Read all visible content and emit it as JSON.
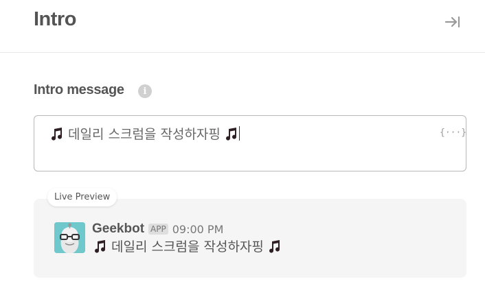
{
  "header": {
    "title": "Intro",
    "collapse_icon": "collapse-right-icon"
  },
  "intro_message": {
    "label": "Intro message",
    "info_icon": "info-icon",
    "info_glyph": "i",
    "prefix_icon": "music-note-icon",
    "text": "데일리 스크럼을 작성하자핑",
    "suffix_icon": "music-note-icon",
    "variables_icon": "variables-icon",
    "variables_glyph": "{···}"
  },
  "live_preview": {
    "label": "Live Preview",
    "bot_name": "Geekbot",
    "badge": "APP",
    "time": "09:00 PM",
    "message": "데일리 스크럼을 작성하자핑",
    "avatar_icon": "geekbot-avatar-icon"
  },
  "colors": {
    "text_dark": "#545454",
    "avatar_bg": "#6ec8cc",
    "preview_bg": "#f5f5f5",
    "note_color": "#2d1f24"
  }
}
